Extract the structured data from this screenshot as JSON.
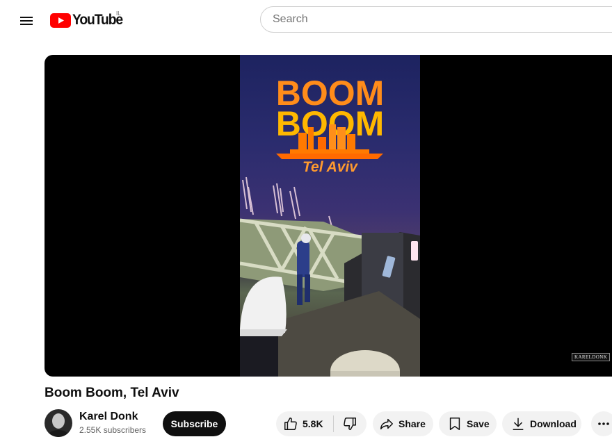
{
  "header": {
    "logo_text": "YouTube",
    "country_code": "IL",
    "search_placeholder": "Search"
  },
  "video": {
    "title": "Boom Boom, Tel Aviv",
    "poster": {
      "line1": "BOOM",
      "line2": "BOOM",
      "subtitle": "Tel Aviv"
    },
    "watermark": "KARELDONK"
  },
  "channel": {
    "name": "Karel Donk",
    "subscribers": "2.55K subscribers"
  },
  "actions": {
    "subscribe_label": "Subscribe",
    "like_count": "5.8K",
    "share_label": "Share",
    "save_label": "Save",
    "download_label": "Download"
  },
  "colors": {
    "brand_red": "#ff0000",
    "poster_orange": "#ff8c1a",
    "poster_yellow": "#ffb800",
    "button_bg": "#f2f2f2",
    "subscribe_bg": "#0f0f0f"
  }
}
